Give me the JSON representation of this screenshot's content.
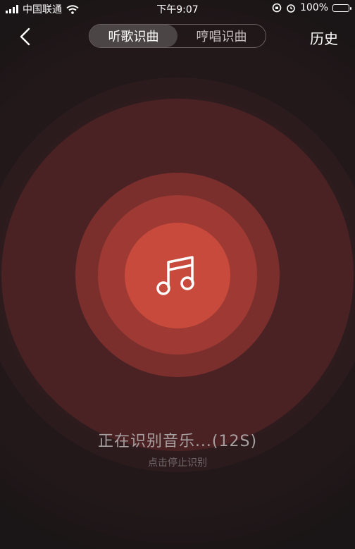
{
  "status_bar": {
    "carrier": "中国联通",
    "time": "下午9:07",
    "battery_percent": "100%",
    "battery_color": "#4cd964"
  },
  "nav": {
    "back_icon": "chevron-left-icon",
    "tabs": [
      {
        "label": "听歌识曲",
        "active": true
      },
      {
        "label": "哼唱识曲",
        "active": false
      }
    ],
    "history_label": "历史"
  },
  "main": {
    "center_icon": "music-note-icon",
    "status_text": "正在识别音乐...(12S)",
    "stop_text": "点击停止识别"
  },
  "colors": {
    "accent": "#c84a3d",
    "background": "#1c1617"
  }
}
